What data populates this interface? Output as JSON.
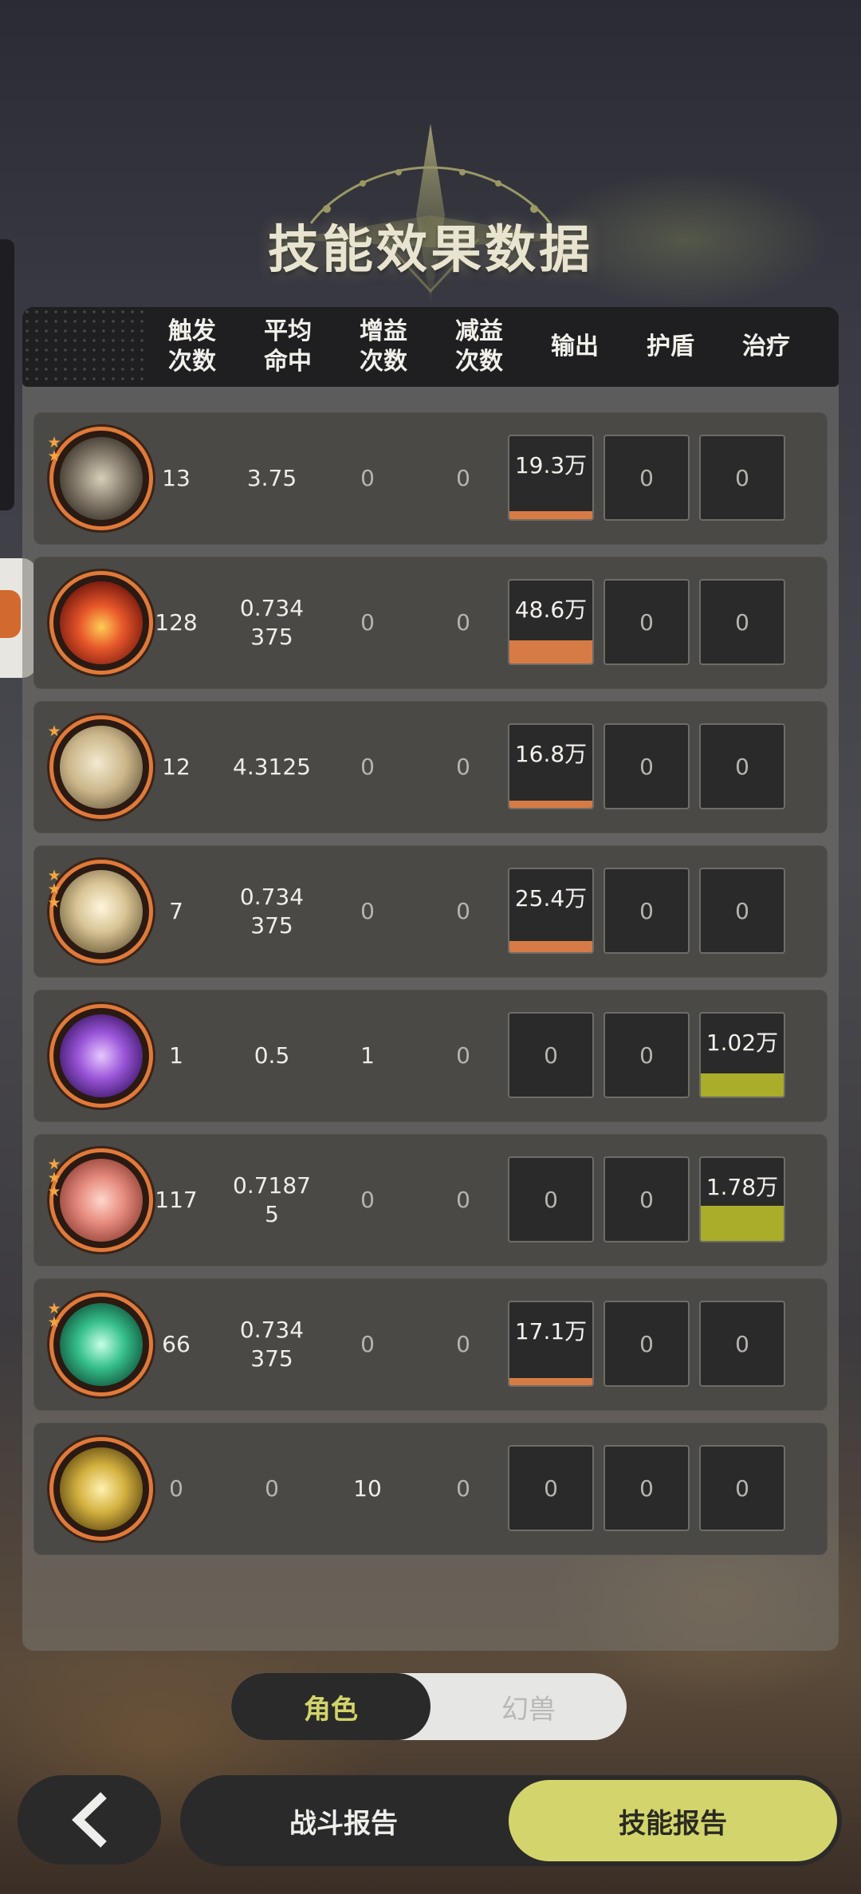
{
  "title": "技能效果数据",
  "headers": [
    "触发\n次数",
    "平均\n命中",
    "增益\n次数",
    "减益\n次数",
    "输出",
    "护盾",
    "治疗"
  ],
  "rows": [
    {
      "icon": "whirlwind-skill-icon",
      "stars": 2,
      "trigger": "13",
      "avg_hit": "3.75",
      "buff": "0",
      "debuff": "0",
      "output": "19.3万",
      "output_fill": 0.1,
      "shield": "0",
      "heal": "0",
      "heal_fill": 0
    },
    {
      "icon": "fire-skill-icon",
      "stars": 0,
      "trigger": "128",
      "avg_hit": "0.734\n375",
      "buff": "0",
      "debuff": "0",
      "output": "48.6万",
      "output_fill": 0.28,
      "shield": "0",
      "heal": "0",
      "heal_fill": 0
    },
    {
      "icon": "wind-slash-skill-icon",
      "stars": 1,
      "trigger": "12",
      "avg_hit": "4.3125",
      "buff": "0",
      "debuff": "0",
      "output": "16.8万",
      "output_fill": 0.09,
      "shield": "0",
      "heal": "0",
      "heal_fill": 0
    },
    {
      "icon": "blade-strike-skill-icon",
      "stars": 3,
      "trigger": "7",
      "avg_hit": "0.734\n375",
      "buff": "0",
      "debuff": "0",
      "output": "25.4万",
      "output_fill": 0.13,
      "shield": "0",
      "heal": "0",
      "heal_fill": 0
    },
    {
      "icon": "purple-orb-skill-icon",
      "stars": 0,
      "trigger": "1",
      "avg_hit": "0.5",
      "buff": "1",
      "debuff": "0",
      "output": "0",
      "output_fill": 0,
      "shield": "0",
      "heal": "1.02万",
      "heal_fill": 0.28
    },
    {
      "icon": "red-sword-skill-icon",
      "stars": 3,
      "trigger": "117",
      "avg_hit": "0.7187\n5",
      "buff": "0",
      "debuff": "0",
      "output": "0",
      "output_fill": 0,
      "shield": "0",
      "heal": "1.78万",
      "heal_fill": 0.42
    },
    {
      "icon": "green-blade-skill-icon",
      "stars": 2,
      "trigger": "66",
      "avg_hit": "0.734\n375",
      "buff": "0",
      "debuff": "0",
      "output": "17.1万",
      "output_fill": 0.09,
      "shield": "0",
      "heal": "0",
      "heal_fill": 0
    },
    {
      "icon": "golden-helm-skill-icon",
      "stars": 0,
      "trigger": "0",
      "avg_hit": "0",
      "buff": "10",
      "debuff": "0",
      "output": "0",
      "output_fill": 0,
      "shield": "0",
      "heal": "0",
      "heal_fill": 0
    }
  ],
  "toggle": {
    "active": "角色",
    "inactive": "幻兽"
  },
  "bottom": {
    "battle_report": "战斗报告",
    "skill_report": "技能报告"
  },
  "colors": {
    "output_bar": "#d77b46",
    "heal_bar": "#a9ad2a",
    "accent": "#d3d56c",
    "icon_ring": "#e07a3a"
  }
}
